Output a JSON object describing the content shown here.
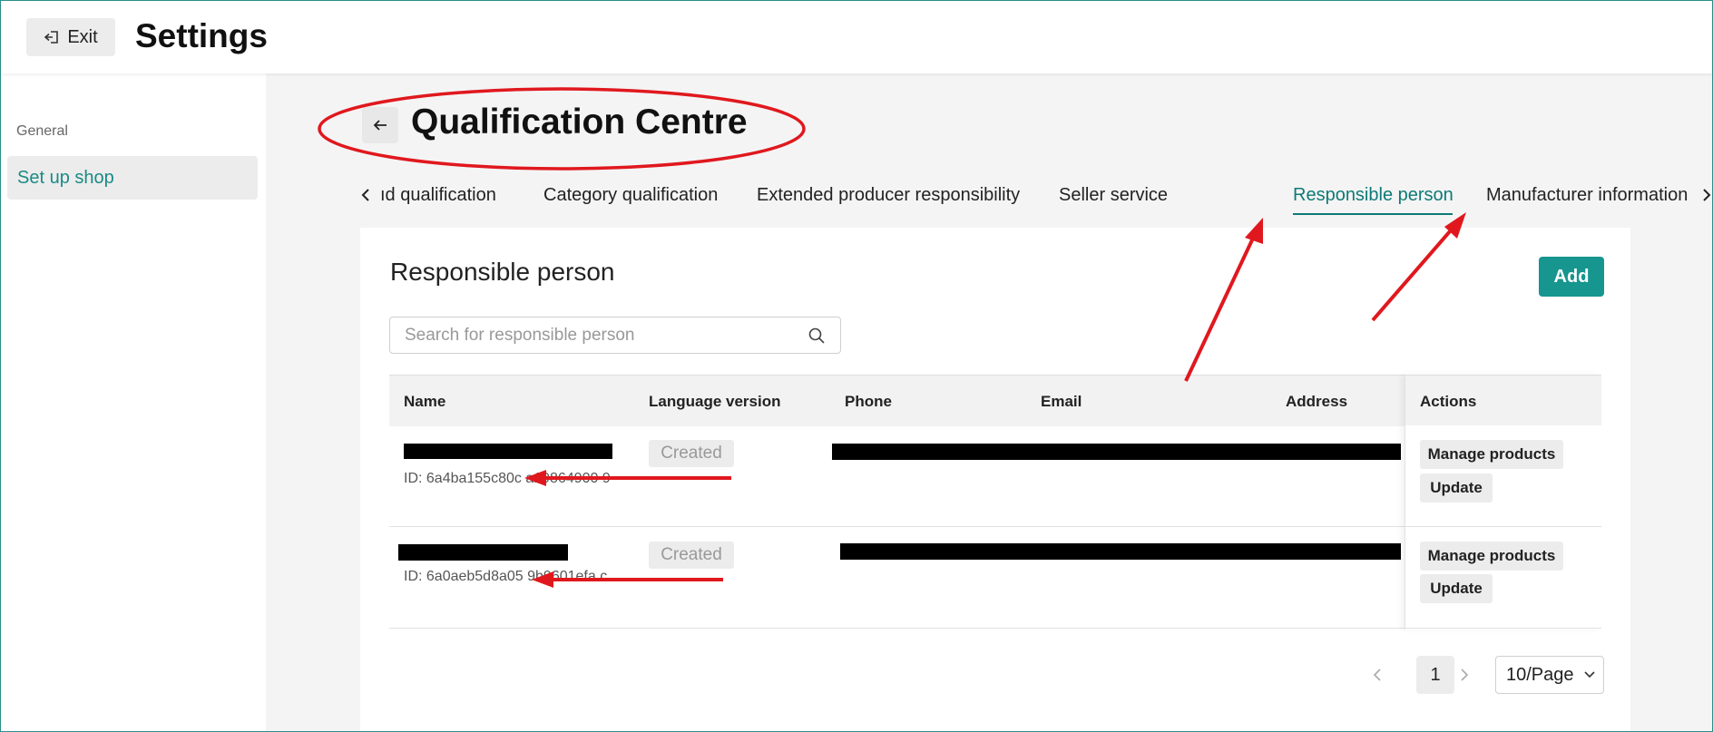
{
  "topbar": {
    "exit_label": "Exit",
    "title": "Settings"
  },
  "sidebar": {
    "group_label": "General",
    "items": [
      {
        "label": "Set up shop",
        "active": true
      }
    ]
  },
  "page": {
    "title": "Qualification Centre"
  },
  "tabs": [
    {
      "label": "ıd qualification",
      "active": false
    },
    {
      "label": "Category qualification",
      "active": false
    },
    {
      "label": "Extended producer responsibility",
      "active": false
    },
    {
      "label": "Seller service",
      "active": false
    },
    {
      "label": "Responsible person",
      "active": true
    },
    {
      "label": "Manufacturer information",
      "active": false
    }
  ],
  "card": {
    "title": "Responsible person",
    "add_label": "Add",
    "search_placeholder": "Search for responsible person"
  },
  "table": {
    "columns": [
      "Name",
      "Language version",
      "Phone",
      "Email",
      "Address",
      "Actions"
    ],
    "rows": [
      {
        "id_text": "ID: 6a4ba155c80c  a19864900 9",
        "status": "Created",
        "actions": [
          "Manage products",
          "Update"
        ]
      },
      {
        "id_text": "ID: 6a0aeb5d8a05  9b9601efa c",
        "status": "Created",
        "actions": [
          "Manage products",
          "Update"
        ]
      }
    ]
  },
  "pagination": {
    "current_page": "1",
    "page_size": "10/Page"
  },
  "colors": {
    "accent": "#17958f",
    "annotation": "#e0181e"
  }
}
